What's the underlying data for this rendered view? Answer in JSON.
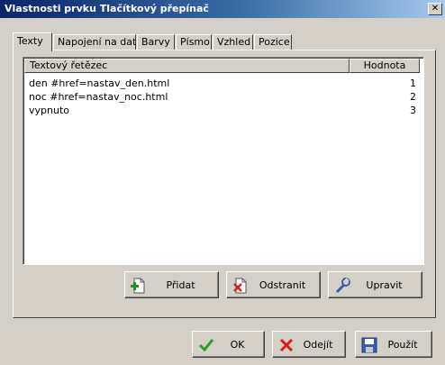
{
  "window": {
    "title": "Vlastnosti prvku Tlačítkový přepínač",
    "close_glyph": "✕"
  },
  "tabs": [
    {
      "label": "Texty",
      "active": true
    },
    {
      "label": "Napojení na data",
      "active": false
    },
    {
      "label": "Barvy",
      "active": false
    },
    {
      "label": "Písmo",
      "active": false
    },
    {
      "label": "Vzhled",
      "active": false
    },
    {
      "label": "Pozice",
      "active": false
    }
  ],
  "list": {
    "columns": [
      "Textový řetězec",
      "Hodnota"
    ],
    "rows": [
      {
        "text": "den #href=nastav_den.html",
        "value": "1"
      },
      {
        "text": "noc #href=nastav_noc.html",
        "value": "2"
      },
      {
        "text": "vypnuto",
        "value": "3"
      }
    ]
  },
  "list_buttons": {
    "add": {
      "label": "Přidat",
      "icon": "add-icon"
    },
    "remove": {
      "label": "Odstranit",
      "icon": "remove-icon"
    },
    "edit": {
      "label": "Upravit",
      "icon": "edit-icon"
    }
  },
  "dialog_buttons": {
    "ok": {
      "label": "OK",
      "icon": "checkmark-icon"
    },
    "cancel": {
      "label": "Odejít",
      "icon": "cancel-icon"
    },
    "apply": {
      "label": "Použít",
      "icon": "save-icon"
    }
  },
  "colors": {
    "title_bar_start": "#0a246a",
    "title_bar_end": "#a6caf0",
    "face": "#d4d0c8",
    "check_green": "#2e9a2e",
    "cross_red": "#d42020"
  }
}
